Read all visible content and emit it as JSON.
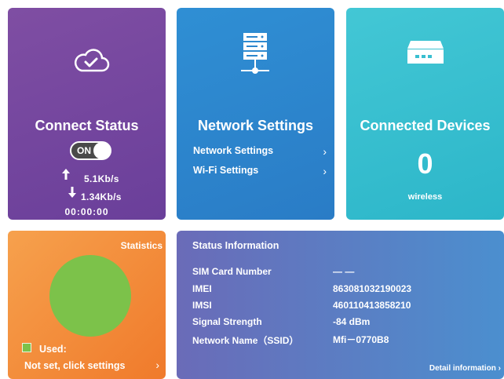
{
  "connect": {
    "title": "Connect Status",
    "toggle_label": "ON",
    "upload_speed": "5.1Kb/s",
    "download_speed": "1.34Kb/s",
    "duration": "00:00:00",
    "icon": "cloud-check-icon"
  },
  "network": {
    "title": "Network Settings",
    "links": [
      {
        "label": "Network Settings"
      },
      {
        "label": "Wi-Fi Settings"
      }
    ],
    "icon": "server-icon"
  },
  "devices": {
    "title": "Connected Devices",
    "count": "0",
    "type_label": "wireless",
    "icon": "router-icon"
  },
  "statistics": {
    "title": "Statistics",
    "legend_label": "Used:",
    "link_label": "Not set, click settings",
    "used_color": "#7cc24a"
  },
  "status_info": {
    "title": "Status Information",
    "rows": [
      {
        "label": "SIM Card Number",
        "value": "— —"
      },
      {
        "label": "IMEI",
        "value": "863081032190023"
      },
      {
        "label": "IMSI",
        "value": "460110413858210"
      },
      {
        "label": "Signal Strength",
        "value": "-84 dBm"
      },
      {
        "label": "Network Name（SSID）",
        "value": "Mfi－0770B8"
      }
    ],
    "detail_link": "Detail information"
  },
  "colors": {
    "connect_card": "#6f449d",
    "network_card": "#2c86cd",
    "devices_card": "#39bfd0",
    "stats_card": "#f38a38",
    "status_card": "#5b7dc2"
  }
}
